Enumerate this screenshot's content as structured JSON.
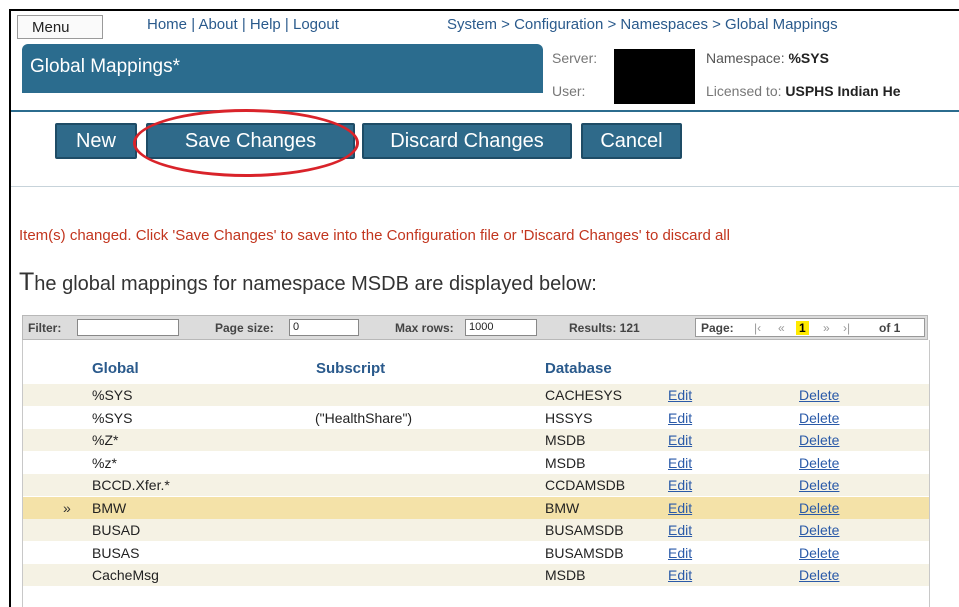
{
  "nav": {
    "menu_label": "Menu",
    "links": [
      "Home",
      "About",
      "Help",
      "Logout"
    ],
    "separator": "|",
    "breadcrumb": "System > Configuration > Namespaces > Global Mappings"
  },
  "page_title": "Global Mappings*",
  "info": {
    "server_label": "Server:",
    "user_label": "User:",
    "namespace_label": "Namespace:",
    "namespace_value": "%SYS",
    "licensed_label": "Licensed to:",
    "licensed_value": "USPHS Indian He"
  },
  "buttons": {
    "new": "New",
    "save": "Save Changes",
    "discard": "Discard Changes",
    "cancel": "Cancel"
  },
  "changed_message": "Item(s) changed. Click 'Save Changes' to save into the Configuration file or 'Discard Changes' to discard all",
  "heading": {
    "first_letter": "T",
    "rest": "he global mappings for namespace MSDB are displayed below:"
  },
  "filter": {
    "filter_label": "Filter:",
    "filter_value": "",
    "page_size_label": "Page size:",
    "page_size_value": "0",
    "max_rows_label": "Max rows:",
    "max_rows_value": "1000",
    "results_label": "Results: 121",
    "page_label": "Page:",
    "first_nav": "|‹",
    "prev_nav": "«",
    "current_page": "1",
    "next_nav": "»",
    "last_nav": "›|",
    "of_pages": "of 1"
  },
  "columns": [
    "Global",
    "Subscript",
    "Database"
  ],
  "rows": [
    {
      "global": "%SYS",
      "subscript": "",
      "database": "CACHESYS",
      "edit": "Edit",
      "delete": "Delete"
    },
    {
      "global": "%SYS",
      "subscript": "(\"HealthShare\")",
      "database": "HSSYS",
      "edit": "Edit",
      "delete": "Delete"
    },
    {
      "global": "%Z*",
      "subscript": "",
      "database": "MSDB",
      "edit": "Edit",
      "delete": "Delete"
    },
    {
      "global": "%z*",
      "subscript": "",
      "database": "MSDB",
      "edit": "Edit",
      "delete": "Delete"
    },
    {
      "global": "BCCD.Xfer.*",
      "subscript": "",
      "database": "CCDAMSDB",
      "edit": "Edit",
      "delete": "Delete"
    },
    {
      "global": "BMW",
      "subscript": "",
      "database": "BMW",
      "edit": "Edit",
      "delete": "Delete",
      "marker": "»"
    },
    {
      "global": "BUSAD",
      "subscript": "",
      "database": "BUSAMSDB",
      "edit": "Edit",
      "delete": "Delete"
    },
    {
      "global": "BUSAS",
      "subscript": "",
      "database": "BUSAMSDB",
      "edit": "Edit",
      "delete": "Delete"
    },
    {
      "global": "CacheMsg",
      "subscript": "",
      "database": "MSDB",
      "edit": "Edit",
      "delete": "Delete"
    }
  ],
  "colors": {
    "header_blue": "#2b6c8e",
    "button_blue": "#2f6a8a",
    "annotation_red": "#d9232a",
    "message_red": "#c2351e",
    "selected_row": "#f4e2a8",
    "odd_row": "#f5f2e4"
  }
}
